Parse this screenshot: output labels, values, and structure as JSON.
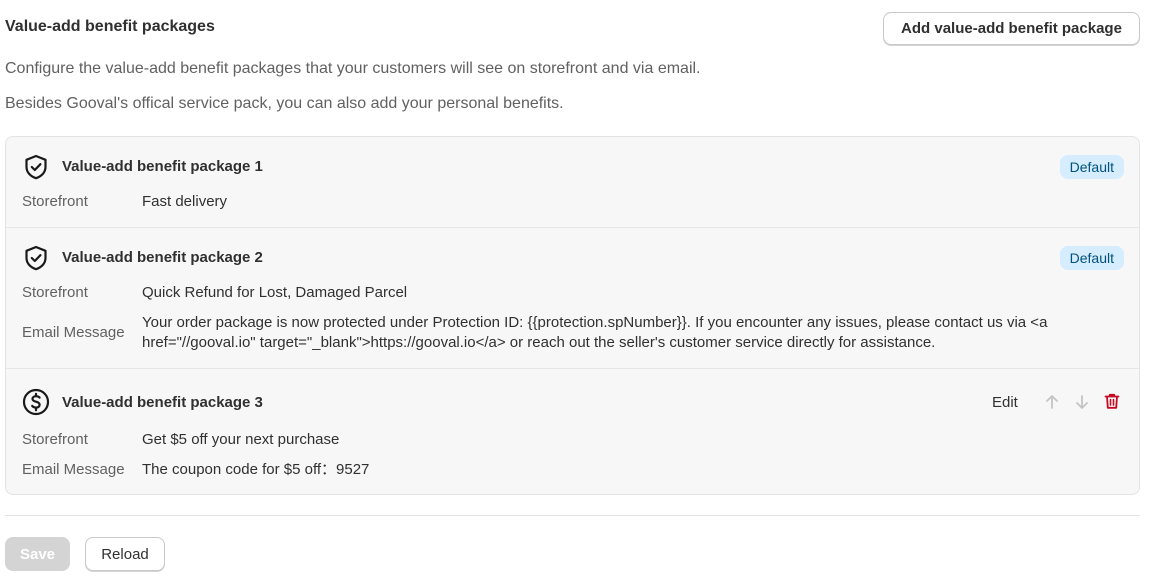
{
  "header": {
    "title": "Value-add benefit packages",
    "add_button_label": "Add value-add benefit package"
  },
  "description": {
    "line1": "Configure the value-add benefit packages that your customers will see on storefront and via email.",
    "line2": "Besides Gooval's offical service pack, you can also add your personal benefits."
  },
  "packages": [
    {
      "icon": "shield-check-icon",
      "title": "Value-add benefit package 1",
      "badge": "Default",
      "storefront_label": "Storefront",
      "storefront_value": "Fast delivery"
    },
    {
      "icon": "shield-check-icon",
      "title": "Value-add benefit package 2",
      "badge": "Default",
      "storefront_label": "Storefront",
      "storefront_value": "Quick Refund for Lost, Damaged Parcel",
      "email_label": "Email Message",
      "email_value": "Your order package is now protected under Protection ID: {{protection.spNumber}}. If you encounter any issues, please contact us via <a href=\"//gooval.io\" target=\"_blank\">https://gooval.io</a> or reach out the seller's customer service directly for assistance."
    },
    {
      "icon": "dollar-circle-icon",
      "title": "Value-add benefit package 3",
      "edit_label": "Edit",
      "action_icons": [
        "arrow-up-icon",
        "arrow-down-icon",
        "trash-icon"
      ],
      "storefront_label": "Storefront",
      "storefront_value": "Get $5 off your next purchase",
      "email_label": "Email Message",
      "email_value": "The coupon code for $5 off：9527"
    }
  ],
  "footer": {
    "save_label": "Save",
    "reload_label": "Reload"
  },
  "colors": {
    "badge_bg": "#d6ecff",
    "badge_text": "#00527c",
    "delete": "#c70a24",
    "disabled_arrow": "#c4c4c4",
    "save_disabled_bg": "#d4d4d4"
  }
}
